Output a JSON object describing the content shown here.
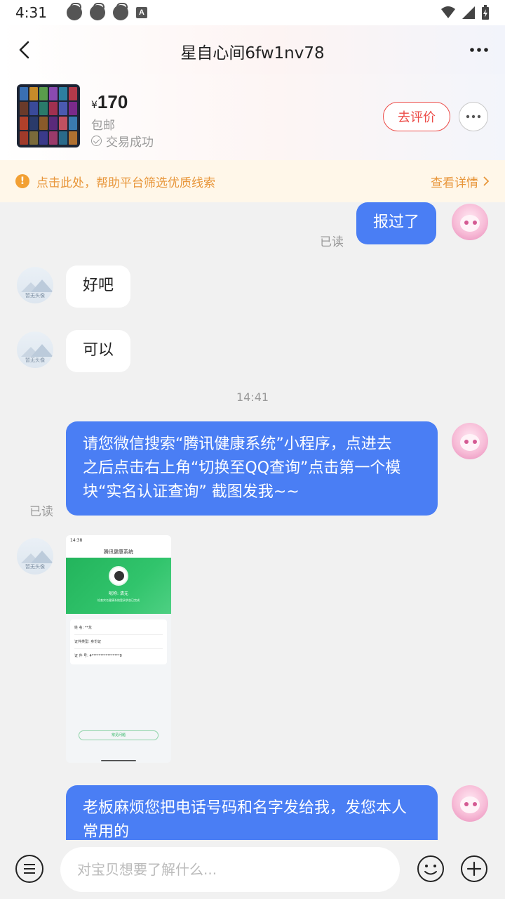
{
  "status_bar": {
    "time": "4:31",
    "notification_letter": "A"
  },
  "header": {
    "title": "星自心间6fw1nv78"
  },
  "product": {
    "currency": "¥",
    "price": "170",
    "shipping": "包邮",
    "status": "交易成功",
    "review_button": "去评价"
  },
  "notice": {
    "icon_char": "!",
    "text": "点击此处，帮助平台筛选优质线索",
    "detail_label": "查看详情"
  },
  "messages": {
    "m1": {
      "text": "报过了",
      "read": "已读"
    },
    "m2": {
      "text": "好吧",
      "avatar_caption": "暂无头像"
    },
    "m3": {
      "text": "可以",
      "avatar_caption": "暂无头像"
    },
    "timestamp": "14:41",
    "m4": {
      "line1": "请您微信搜索“腾讯健康系统”小程序，点进去",
      "line2": "之后点击右上角“切换至QQ查询”点击第一个模",
      "line3": "块“实名认证查询” 截图发我~~",
      "read": "已读"
    },
    "m5": {
      "avatar_caption": "暂无头像",
      "shot_time": "14:38",
      "shot_title": "腾讯健康系统",
      "shot_nick": "昵称:  清无",
      "shot_sub": "检查实名健康系统登录状态已完成",
      "rows": [
        "姓      名:   **龙",
        "证件类型:    身份证",
        "证 件 号:   4****************8"
      ],
      "shot_button": "常见问题"
    },
    "m6": {
      "line1": "老板麻烦您把电话号码和名字发给我，发您本人",
      "line2": "常用的"
    }
  },
  "input": {
    "placeholder": "对宝贝想要了解什么..."
  },
  "colors": {
    "accent_blue": "#4a7ef4",
    "review_red": "#ec4c48",
    "notice_orange": "#e8963a"
  }
}
